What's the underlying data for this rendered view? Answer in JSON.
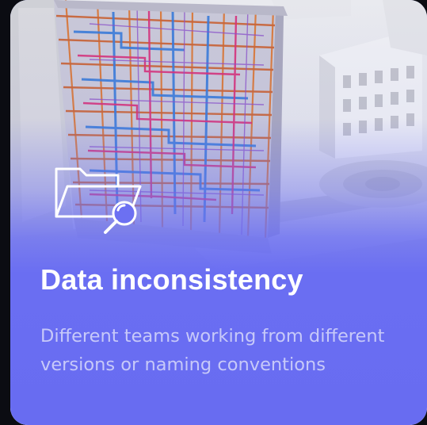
{
  "card": {
    "title": "Data inconsistency",
    "description": "Different teams working from different versions or naming conventions",
    "icon": "folder-search-icon",
    "image": "building-model-render"
  },
  "colors": {
    "accent": "#6c70f2",
    "title_text": "#ffffff",
    "description_text": "#c7c9f9",
    "background": "#0b0c12"
  }
}
